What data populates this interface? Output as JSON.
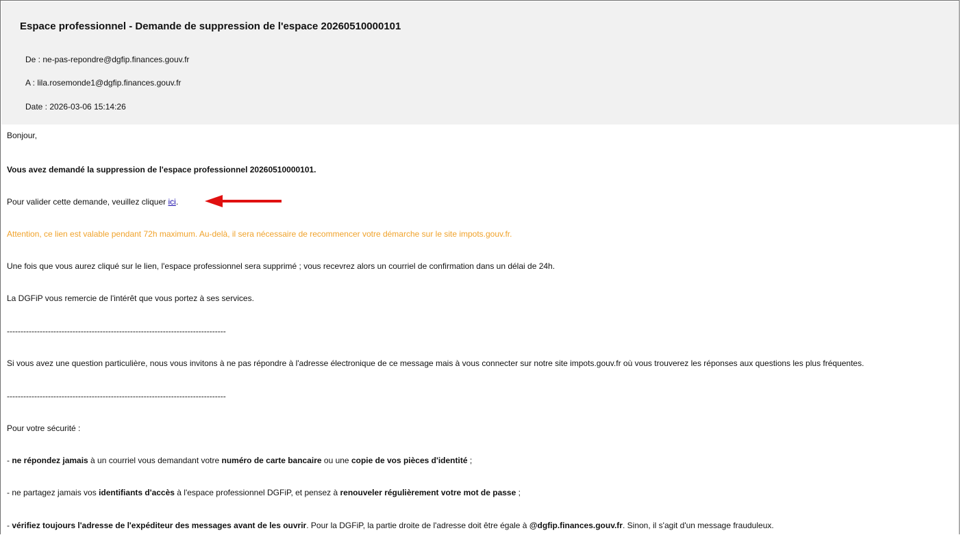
{
  "email": {
    "subject": "Espace professionnel - Demande de suppression de l'espace 20260510000101",
    "from": "De : ne-pas-repondre@dgfip.finances.gouv.fr",
    "to": "A : lila.rosemonde1@dgfip.finances.gouv.fr",
    "date": "Date : 2026-03-06 15:14:26"
  },
  "body": {
    "greeting": "Bonjour,",
    "request_statement": "Vous avez demandé la suppression de l'espace professionnel 20260510000101.",
    "validate_prefix": "Pour valider cette demande, veuillez cliquer ",
    "validate_link": "ici",
    "validate_suffix": ".",
    "warning": "Attention, ce lien est valable pendant 72h maximum. Au-delà, il sera nécessaire de recommencer votre démarche sur le site impots.gouv.fr.",
    "after_click": "Une fois que vous aurez cliqué sur le lien, l'espace professionnel sera supprimé ; vous recevrez alors un courriel de confirmation dans un délai de 24h.",
    "thanks": "La DGFiP vous remercie de l'intérêt que vous portez à ses services.",
    "separator_1": "--------------------------------------------------------------------------------",
    "question": "Si vous avez une question particulière, nous vous invitons à ne pas répondre à l'adresse électronique de ce message mais à vous connecter sur notre site impots.gouv.fr où vous trouverez les réponses aux questions les plus fréquentes.",
    "separator_2": "--------------------------------------------------------------------------------",
    "security_heading": "Pour votre sécurité :",
    "tip1": {
      "p1": "- ",
      "b1": "ne répondez jamais",
      "p2": " à un courriel vous demandant votre ",
      "b2": "numéro de carte bancaire",
      "p3": " ou une ",
      "b3": "copie de vos pièces d'identité",
      "p4": " ;"
    },
    "tip2": {
      "p1": "- ne partagez jamais vos ",
      "b1": "identifiants d'accès",
      "p2": " à l'espace professionnel DGFiP, et pensez à ",
      "b2": "renouveler régulièrement votre mot de passe",
      "p3": " ;"
    },
    "tip3": {
      "p1": "- ",
      "b1": "vérifiez toujours l'adresse de l'expéditeur des messages avant de les ouvrir",
      "p2": ". Pour la DGFiP, la partie droite de l'adresse doit être égale à ",
      "b2": "@dgfip.finances.gouv.fr",
      "p3": ". Sinon, il s'agit d'un message frauduleux."
    }
  },
  "annotation": {
    "arrow_color": "#e01010"
  }
}
